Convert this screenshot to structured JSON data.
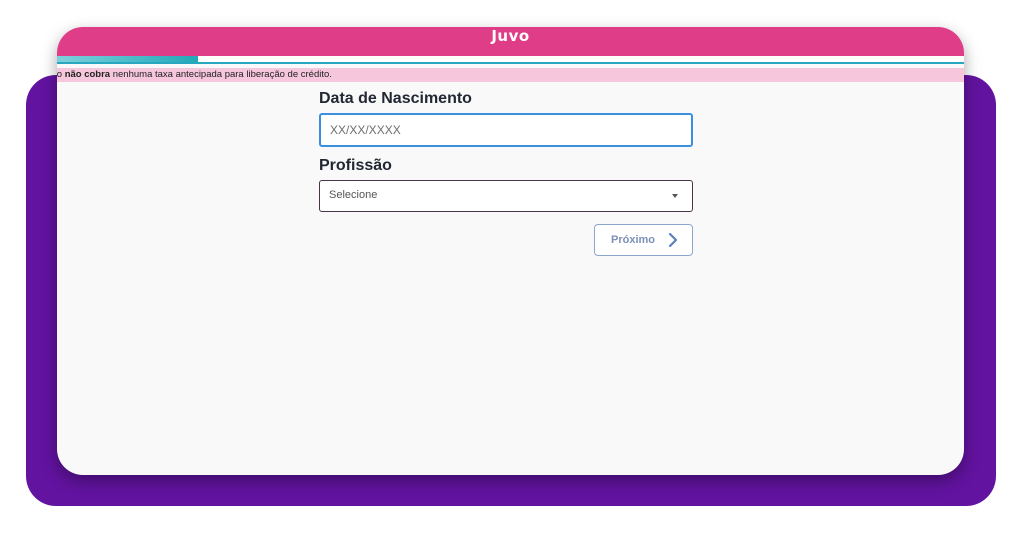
{
  "header": {
    "logo_text": "Juvo",
    "brand_color": "#df3d87"
  },
  "progress": {
    "fraction": 0.155,
    "fill_color": "#22a9b8"
  },
  "notice": {
    "prefix": "vo ",
    "bold": "não cobra",
    "rest": " nenhuma taxa antecipada para liberação de crédito."
  },
  "form": {
    "birth_label": "Data de Nascimento",
    "birth_placeholder": "XX/XX/XXXX",
    "profession_label": "Profissão",
    "profession_value": "Selecione",
    "next_label": "Próximo"
  },
  "icons": {
    "dropdown": "chevron-down-icon",
    "next": "chevron-right-icon"
  },
  "colors": {
    "backdrop": "#6213a0",
    "notice_bg": "#f5c6dc",
    "input_focus": "#3b8fe0"
  }
}
